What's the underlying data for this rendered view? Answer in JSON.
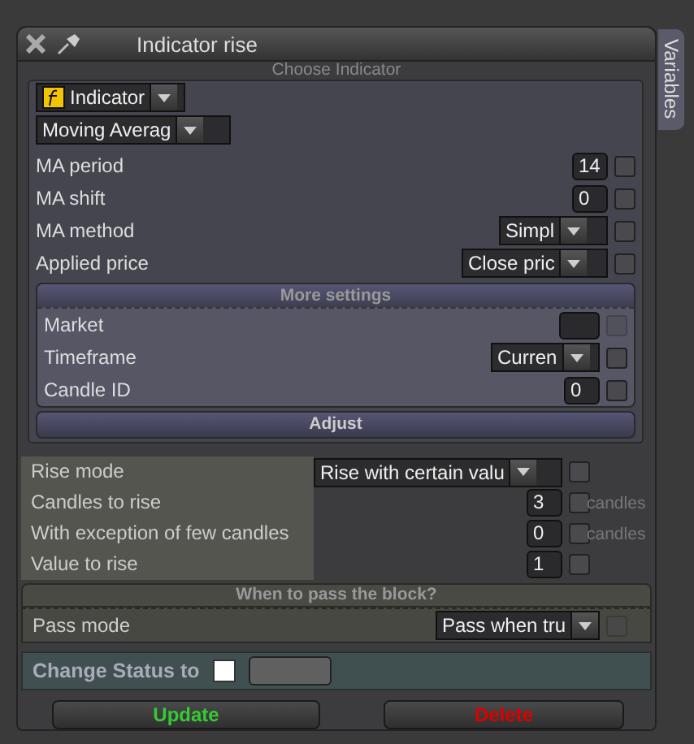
{
  "window": {
    "title": "Indicator rise"
  },
  "side_tab": "Variables",
  "choose_indicator": {
    "header": "Choose Indicator",
    "type_select": "Indicator",
    "indicator_select": "Moving Averag",
    "rows": [
      {
        "kind": "number",
        "label": "MA period",
        "value": "14",
        "checked": false
      },
      {
        "kind": "number",
        "label": "MA shift",
        "value": "0",
        "checked": false
      },
      {
        "kind": "select",
        "label": "MA method",
        "value": "Simpl",
        "checked": false
      },
      {
        "kind": "select",
        "label": "Applied price",
        "value": "Close pric",
        "checked": false
      }
    ],
    "more_settings": {
      "header": "More settings",
      "rows": [
        {
          "kind": "blank",
          "label": "Market",
          "checked": false,
          "disabled": true
        },
        {
          "kind": "select",
          "label": "Timeframe",
          "value": "Curren",
          "checked": false,
          "disabled": false
        },
        {
          "kind": "number",
          "label": "Candle ID",
          "value": "0",
          "checked": false,
          "disabled": false
        }
      ]
    },
    "adjust": "Adjust"
  },
  "rise_rows": [
    {
      "kind": "wide-select",
      "label": "Rise mode",
      "value": "Rise with certain valu",
      "checked": false
    },
    {
      "kind": "number",
      "label": "Candles to rise",
      "value": "3",
      "checked": false,
      "suffix": "candles"
    },
    {
      "kind": "number",
      "label": "With exception of few candles",
      "value": "0",
      "checked": false,
      "suffix": "candles"
    },
    {
      "kind": "number",
      "label": "Value to rise",
      "value": "1",
      "checked": false
    }
  ],
  "pass": {
    "header": "When to pass the block?",
    "label": "Pass mode",
    "value": "Pass when tru",
    "checked": false,
    "disabled": true
  },
  "change_status": {
    "label": "Change Status to",
    "checked": false
  },
  "buttons": [
    {
      "label": "Update",
      "kind": "update"
    },
    {
      "label": "Delete",
      "kind": "delete"
    }
  ]
}
